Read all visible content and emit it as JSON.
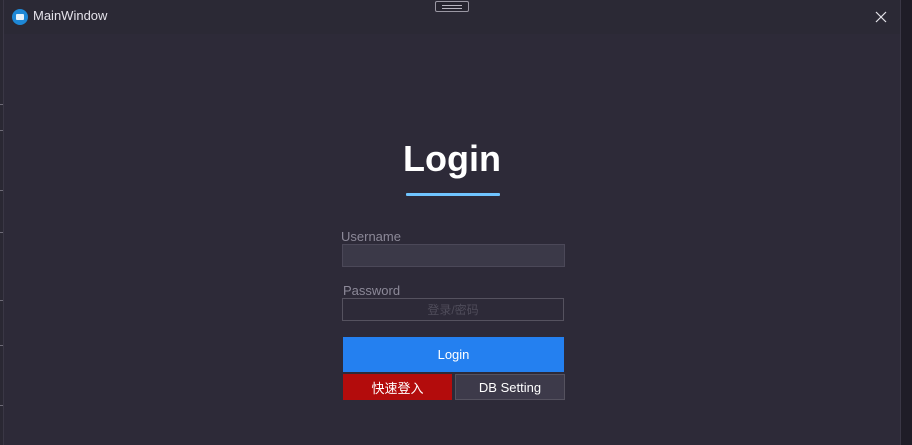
{
  "window": {
    "title": "MainWindow"
  },
  "login": {
    "heading": "Login",
    "username_label": "Username",
    "username_value": "",
    "password_label": "Password",
    "password_placeholder": "登录/密码",
    "login_button": "Login",
    "quick_login_button": "快速登入",
    "db_setting_button": "DB Setting"
  },
  "colors": {
    "accent": "#2480f0",
    "danger": "#b30c0c",
    "underline": "#6fc4ff",
    "background": "#2d2a38"
  },
  "icons": {
    "app": "app-icon",
    "close": "close-icon",
    "drag": "drag-handle-icon"
  }
}
